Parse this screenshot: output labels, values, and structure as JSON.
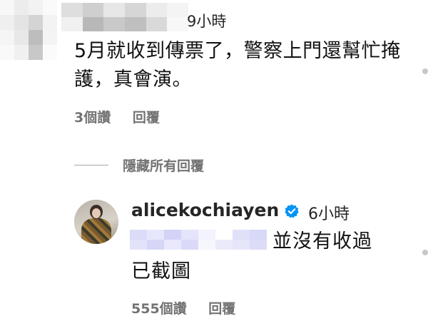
{
  "comment1": {
    "time": "9小時",
    "text": "5月就收到傳票了，警察上門還幫忙掩護，真會演。",
    "likes": "3個讚",
    "reply_label": "回覆"
  },
  "hide_replies_label": "隱藏所有回覆",
  "comment2": {
    "username": "alicekochiayen",
    "time": "6小時",
    "text_line1": "並沒有收過",
    "text_line2": "已截圖",
    "likes": "555個讚",
    "reply_label": "回覆"
  },
  "colors": {
    "text_primary": "#262626",
    "text_secondary": "#737373",
    "verified_badge": "#0095f6"
  }
}
